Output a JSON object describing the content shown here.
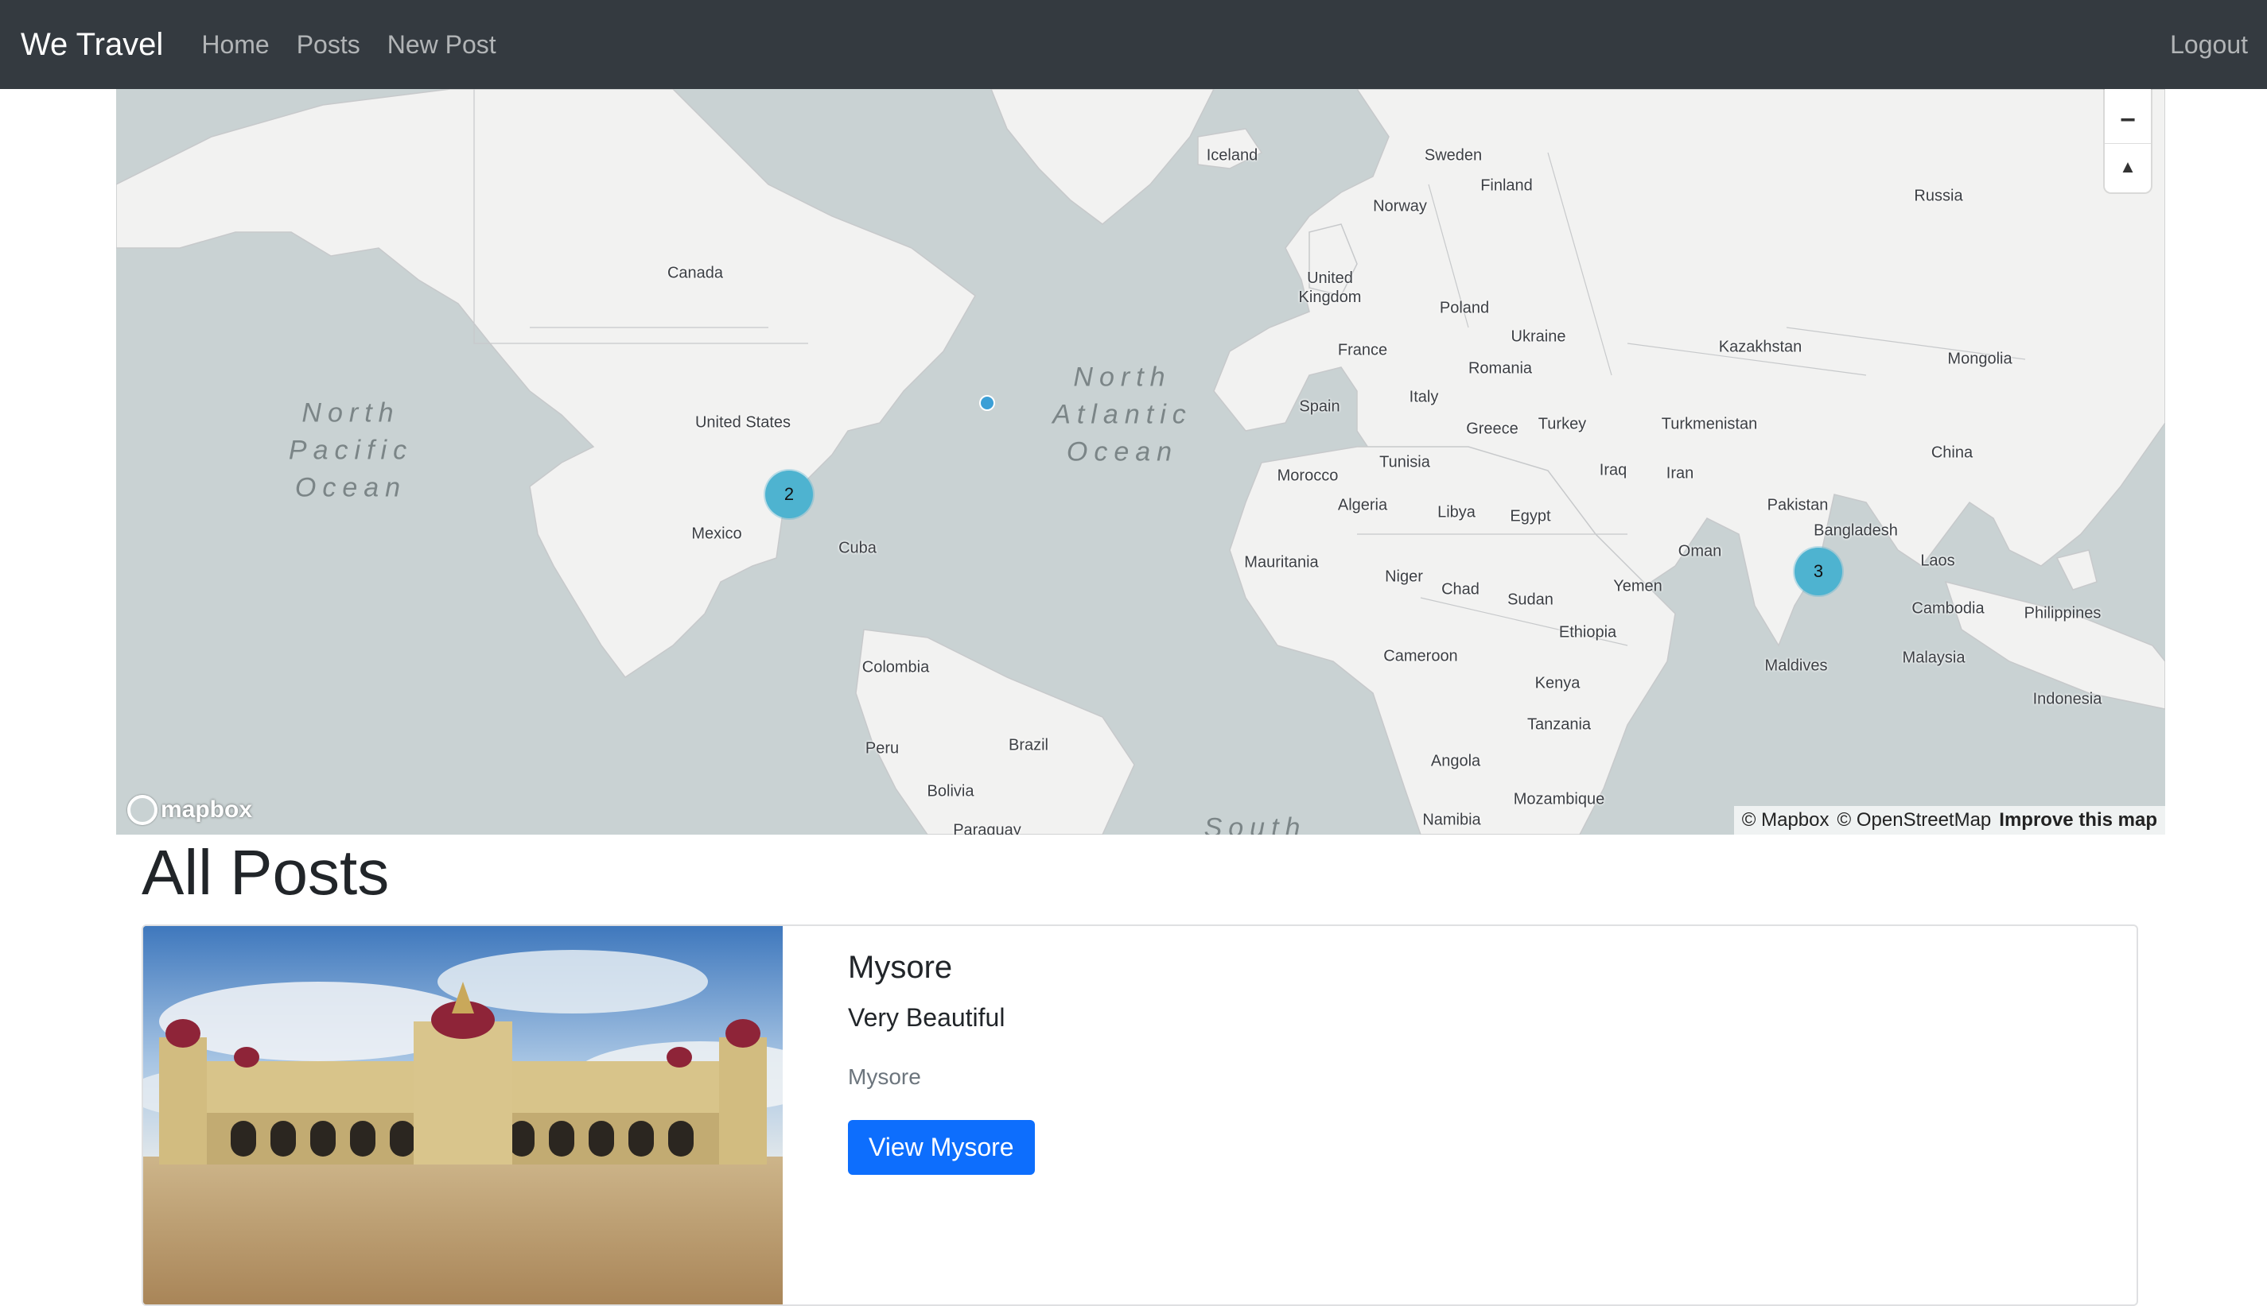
{
  "navbar": {
    "brand": "We Travel",
    "links": [
      "Home",
      "Posts",
      "New Post"
    ],
    "logout": "Logout"
  },
  "map": {
    "country_labels": [
      "Iceland",
      "Sweden",
      "Finland",
      "Norway",
      "Russia",
      "Canada",
      "United Kingdom",
      "Poland",
      "Ukraine",
      "Kazakhstan",
      "Mongolia",
      "France",
      "Romania",
      "United States",
      "Italy",
      "Spain",
      "Turkmenistan",
      "Greece",
      "Turkey",
      "China",
      "Tunisia",
      "Morocco",
      "Iraq",
      "Iran",
      "Algeria",
      "Libya",
      "Egypt",
      "Pakistan",
      "Mexico",
      "Cuba",
      "Bangladesh",
      "Oman",
      "Mauritania",
      "Niger",
      "Laos",
      "Yemen",
      "Chad",
      "Sudan",
      "Cambodia",
      "Philippines",
      "Ethiopia",
      "Cameroon",
      "Maldives",
      "Malaysia",
      "Colombia",
      "Kenya",
      "Indonesia",
      "Tanzania",
      "Brazil",
      "Peru",
      "Angola",
      "Bolivia",
      "Mozambique",
      "Namibia",
      "Paraguay"
    ],
    "ocean_labels": [
      "North\nPacific\nOcean",
      "North\nAtlantic\nOcean",
      "South"
    ],
    "clusters": [
      {
        "count": "2",
        "location": "Gulf of Mexico"
      },
      {
        "count": "3",
        "location": "India"
      }
    ],
    "single_points": 1,
    "controls": {
      "zoom_out": "−",
      "compass": "▲"
    },
    "logo": "mapbox",
    "attribution": {
      "mapbox": "© Mapbox",
      "osm": "© OpenStreetMap",
      "improve": "Improve this map"
    },
    "colors": {
      "water": "#c9d2d3",
      "land": "#f2f2f1",
      "cluster": "#4eb3d0"
    }
  },
  "page_title": "All Posts",
  "post": {
    "title": "Mysore",
    "description": "Very Beautiful",
    "location": "Mysore",
    "button": "View Mysore",
    "image_alt": "Mysore Palace"
  },
  "colors": {
    "navbar": "#343a40",
    "primary": "#0d6efd"
  }
}
